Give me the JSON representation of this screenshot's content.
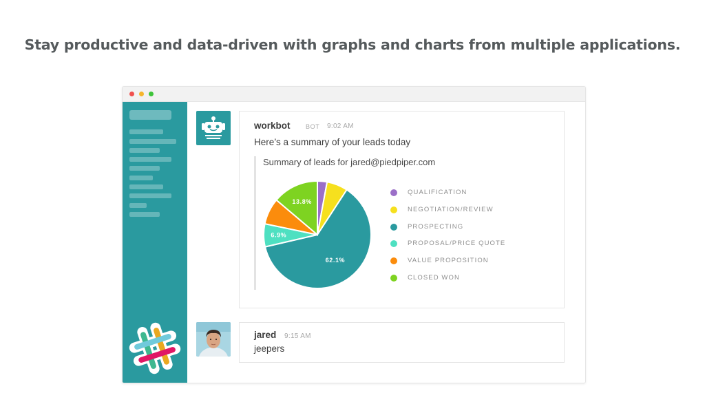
{
  "headline": "Stay productive and data-driven with graphs and charts from multiple applications.",
  "messages": [
    {
      "sender": "workbot",
      "badge": "BOT",
      "time": "9:02 AM",
      "text": "Here’s a summary of your leads today",
      "attachment": {
        "title": "Summary of leads for jared@piedpiper.com"
      }
    },
    {
      "sender": "jared",
      "time": "9:15 AM",
      "text": "jeepers"
    }
  ],
  "chart_data": {
    "type": "pie",
    "title": "Summary of leads for jared@piedpiper.com",
    "legend_position": "right",
    "slices": [
      {
        "label": "QUALIFICATION",
        "value": 2.9,
        "color": "#9b6fc8",
        "value_label": ""
      },
      {
        "label": "NEGOTIATION/REVIEW",
        "value": 6.3,
        "color": "#f6e01e",
        "value_label": ""
      },
      {
        "label": "PROSPECTING",
        "value": 62.1,
        "color": "#2a9a9f",
        "value_label": "62.1%"
      },
      {
        "label": "PROPOSAL/PRICE QUOTE",
        "value": 6.9,
        "color": "#4ee0c1",
        "value_label": "6.9%"
      },
      {
        "label": "VALUE PROPOSITION",
        "value": 7.9,
        "color": "#fb8c0c",
        "value_label": ""
      },
      {
        "label": "CLOSED WON",
        "value": 13.8,
        "color": "#7ed321",
        "value_label": "13.8%"
      }
    ]
  }
}
